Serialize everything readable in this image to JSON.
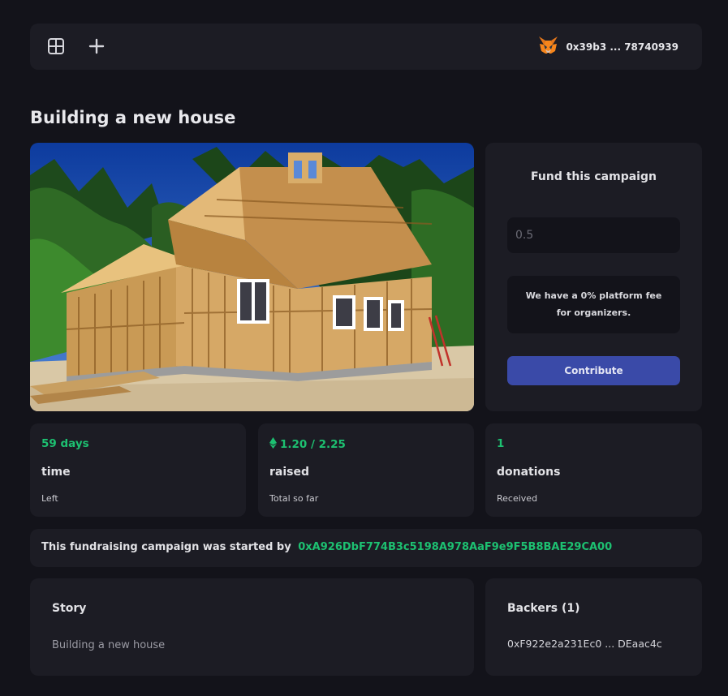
{
  "header": {
    "icons": [
      "dashboard-icon",
      "plus-icon",
      "metamask-fox-icon"
    ],
    "account_address": "0x39b3 ... 78740939"
  },
  "campaign": {
    "title": "Building a new house",
    "image_alt": "House under construction"
  },
  "fund": {
    "title": "Fund this campaign",
    "amount_placeholder": "0.5",
    "fee_note": "We have a 0% platform fee for organizers.",
    "button_label": "Contribute"
  },
  "stats": {
    "time": {
      "value": "59 days",
      "label": "time",
      "sub": "Left"
    },
    "raised": {
      "value": "1.20 / 2.25",
      "label": "raised",
      "sub": "Total so far",
      "icon": "ethereum-icon"
    },
    "donations": {
      "value": "1",
      "label": "donations",
      "sub": "Received"
    }
  },
  "creator": {
    "prefix": "This fundraising campaign was started by",
    "address": "0xA926DbF774B3c5198A978AaF9e9F5B8BAE29CA00"
  },
  "story": {
    "title": "Story",
    "text": "Building a new house"
  },
  "backers": {
    "title": "Backers (1)",
    "items": [
      "0xF922e2a231Ec0 ... DEaac4c"
    ]
  },
  "colors": {
    "background": "#13131a",
    "card": "#1c1c24",
    "accent_green": "#1dc071",
    "button_blue": "#3a4aa8"
  }
}
